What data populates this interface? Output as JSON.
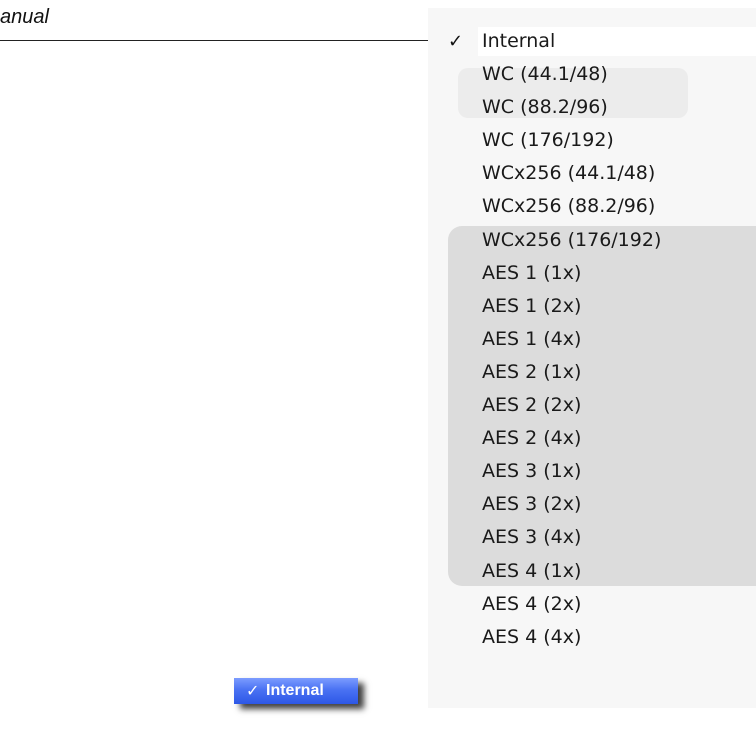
{
  "page": {
    "title_fragment": "anual"
  },
  "clock_menu": {
    "items": [
      {
        "label": "Internal",
        "checked": true
      },
      {
        "label": "WC (44.1/48)",
        "checked": false
      },
      {
        "label": "WC (88.2/96)",
        "checked": false
      },
      {
        "label": "WC (176/192)",
        "checked": false
      },
      {
        "label": "WCx256 (44.1/48)",
        "checked": false
      },
      {
        "label": "WCx256 (88.2/96)",
        "checked": false
      },
      {
        "label": "WCx256 (176/192)",
        "checked": false
      },
      {
        "label": "AES 1 (1x)",
        "checked": false
      },
      {
        "label": "AES 1 (2x)",
        "checked": false
      },
      {
        "label": "AES 1 (4x)",
        "checked": false
      },
      {
        "label": "AES 2 (1x)",
        "checked": false
      },
      {
        "label": "AES 2 (2x)",
        "checked": false
      },
      {
        "label": "AES 2 (4x)",
        "checked": false
      },
      {
        "label": "AES 3 (1x)",
        "checked": false
      },
      {
        "label": "AES 3 (2x)",
        "checked": false
      },
      {
        "label": "AES 3 (4x)",
        "checked": false
      },
      {
        "label": "AES 4 (1x)",
        "checked": false
      },
      {
        "label": "AES 4 (2x)",
        "checked": false
      },
      {
        "label": "AES 4 (4x)",
        "checked": false
      }
    ],
    "check_glyph": "✓"
  },
  "mini_menu": {
    "label": "Internal",
    "check_glyph": "✓",
    "highlight_color": "#3d66ee"
  }
}
